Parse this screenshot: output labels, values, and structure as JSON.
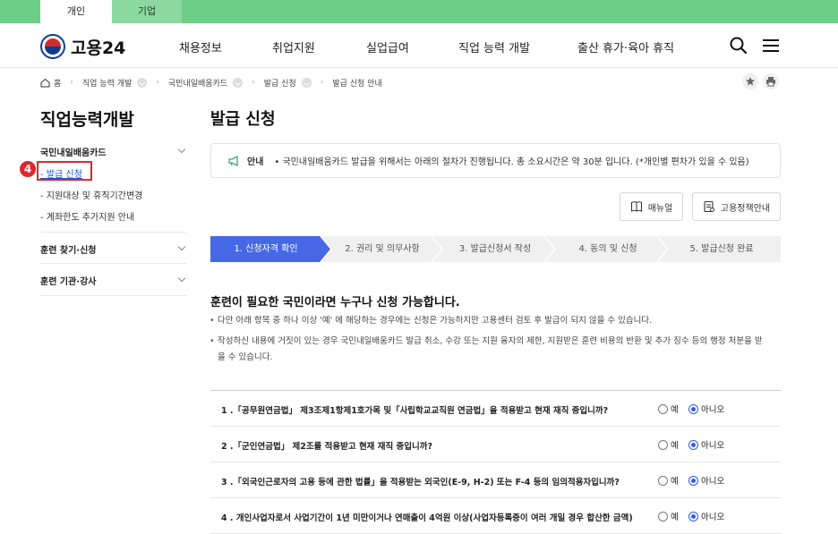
{
  "top_tabs": [
    {
      "label": "개인",
      "active": true
    },
    {
      "label": "기업",
      "active": false
    }
  ],
  "header": {
    "logo_text": "고용24",
    "nav": [
      "채용정보",
      "취업지원",
      "실업급여",
      "직업 능력 개발",
      "출산 휴가·육아 휴직"
    ]
  },
  "breadcrumb": [
    "홈",
    "직업 능력 개발",
    "국민내일배움카드",
    "발급 신청",
    "발급 신청 안내"
  ],
  "sidebar": {
    "title": "직업능력개발",
    "groups": [
      {
        "label": "국민내일배움카드",
        "subitems": [
          "- 발급 신청",
          "- 지원대상 및 휴직기간변경",
          "- 계좌한도 추가지원 안내"
        ]
      },
      {
        "label": "훈련 찾기·신청"
      },
      {
        "label": "훈련 기관·강사"
      }
    ],
    "annotation_badge": "4"
  },
  "main": {
    "title": "발급 신청",
    "notice_label": "안내",
    "notice_text": "• 국민내일배움카드 발급을 위해서는 아래의 절차가 진행됩니다. 총 소요시간은 약 30분 입니다. (*개인별 편차가 있을 수 있음)",
    "buttons": [
      "매뉴얼",
      "고용정책안내"
    ],
    "steps": [
      "1. 신청자격 확인",
      "2. 권리 및 의무사항",
      "3. 발급신청서 작성",
      "4. 동의 및 신청",
      "5. 발급신청 완료"
    ],
    "section_title": "훈련이 필요한 국민이라면 누구나 신청 가능합니다.",
    "bullets": [
      "다만 아래 항목 중 하나 이상 '예' 에 해당하는 경우에는 신청은 가능하지만 고용센터 검토 후 발급이 되지 않을 수 있습니다.",
      "작성하신 내용에 거짓이 있는 경우 국민내일배움카드 발급 취소, 수강 또는 지원 융자의 제한, 지원받은 훈련 비용의 반환 및 추가 징수 등의 행정 처분을 받",
      "을 수 있습니다."
    ],
    "option_yes": "예",
    "option_no": "아니오",
    "questions": [
      "1 .「공무원연금법」 제3조제1항제1호가목 및「사립학교교직원 연금법」을 적용받고 현재 재직 중입니까?",
      "2 .「군인연금법」 제2조를 적용받고 현재 재직 중입니까?",
      "3 .「외국인근로자의 고용 등에 관한 법률」을 적용받는 외국인(E-9, H-2) 또는 F-4 등의 임의적용자입니까?",
      "4 . 개인사업자로서 사업기간이 1년 미만이거나 연매출이 4억원 이상(사업자등록증이 여러 개일 경우 합산한 금액)"
    ]
  },
  "colors": {
    "topbar": "#6dce88",
    "accent": "#4668e6",
    "annotation": "#e0252b"
  }
}
